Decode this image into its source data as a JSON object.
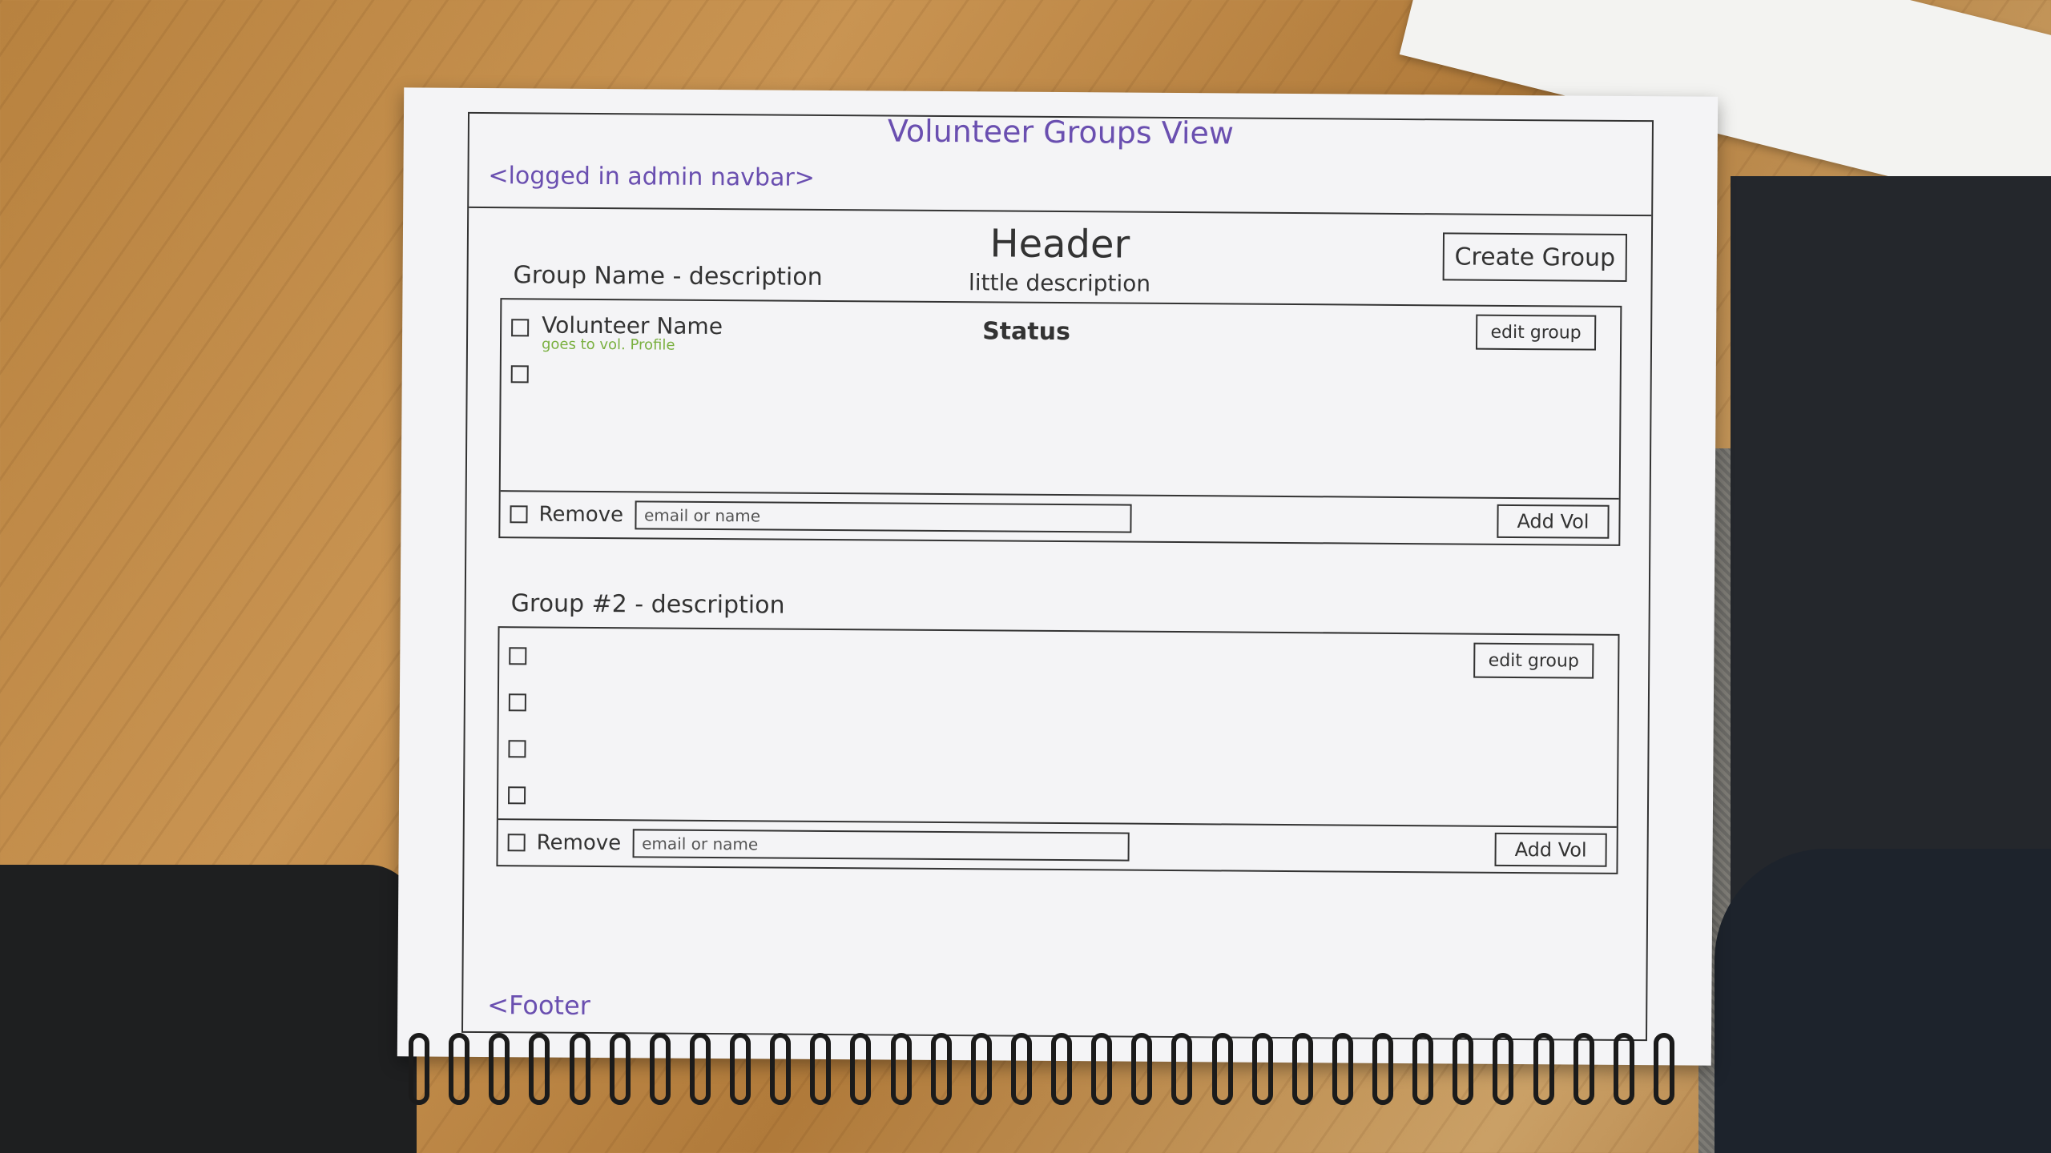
{
  "page": {
    "title": "Volunteer Groups View",
    "navbar": "<logged in admin navbar>",
    "header": {
      "title": "Header",
      "description": "little description"
    },
    "create_group_label": "Create Group",
    "footer": "<Footer"
  },
  "groups": [
    {
      "heading": "Group Name - description",
      "edit_label": "edit group",
      "status_label": "Status",
      "volunteers": [
        {
          "name": "Volunteer Name",
          "detail": "goes to vol. Profile"
        },
        {
          "name": "",
          "detail": ""
        }
      ],
      "remove_label": "Remove",
      "email_placeholder": "email or name",
      "add_label": "Add Vol"
    },
    {
      "heading": "Group #2 - description",
      "edit_label": "edit group",
      "status_label": "",
      "volunteers": [
        {
          "name": "",
          "detail": ""
        },
        {
          "name": "",
          "detail": ""
        },
        {
          "name": "",
          "detail": ""
        },
        {
          "name": "",
          "detail": ""
        }
      ],
      "remove_label": "Remove",
      "email_placeholder": "email or name",
      "add_label": "Add Vol"
    }
  ]
}
